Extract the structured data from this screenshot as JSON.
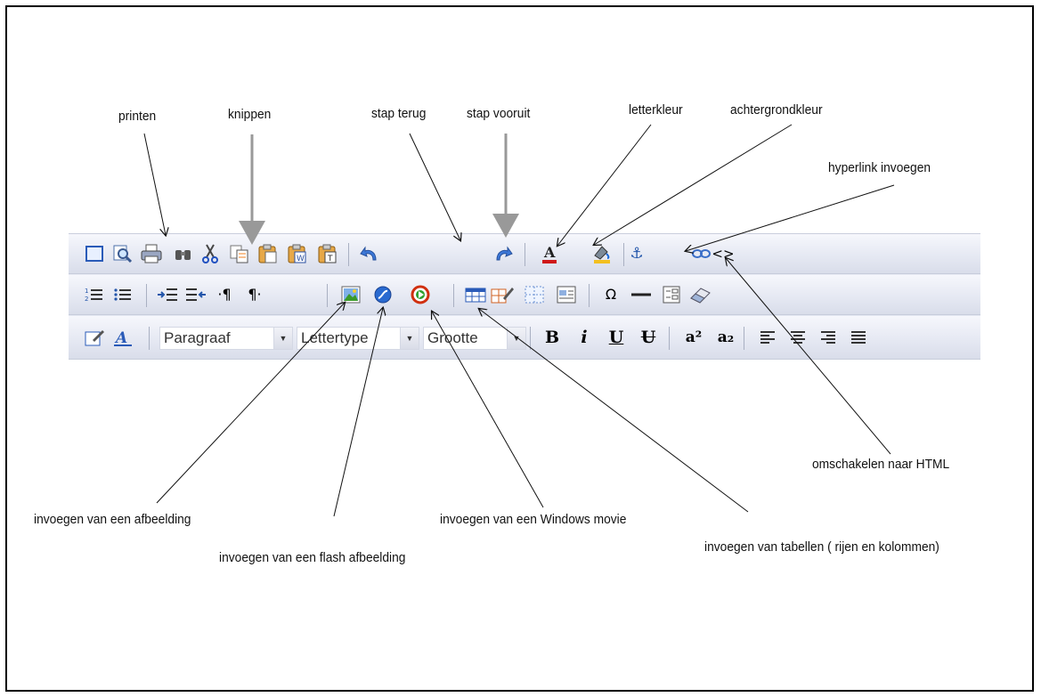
{
  "annotations": {
    "printen": "printen",
    "knippen": "knippen",
    "stap_terug": "stap terug",
    "stap_vooruit": "stap vooruit",
    "letterkleur": "letterkleur",
    "achtergrondkleur": "achtergrondkleur",
    "hyperlink_invoegen": "hyperlink invoegen",
    "omschakelen_html": "omschakelen naar HTML",
    "invoegen_afbeelding": "invoegen van een afbeelding",
    "invoegen_flash": "invoegen van een flash afbeelding",
    "invoegen_movie": "invoegen van een Windows movie",
    "invoegen_tabellen": "invoegen van tabellen ( rijen en kolommen)"
  },
  "toolbar": {
    "paragraph_combo": "Paragraaf",
    "font_combo": "Lettertype",
    "size_combo": "Grootte",
    "bold": "B",
    "italic": "i",
    "underline": "U",
    "strike": "U",
    "superscript": "a²",
    "subscript": "a₂"
  },
  "icons": [
    "full-screen-icon",
    "preview-icon",
    "print-icon",
    "find-icon",
    "cut-icon",
    "copy-icon",
    "paste-icon",
    "paste-word-icon",
    "paste-text-icon",
    "undo-icon",
    "redo-icon",
    "text-color-icon",
    "background-color-icon",
    "anchor-icon",
    "hyperlink-icon",
    "html-source-icon"
  ]
}
